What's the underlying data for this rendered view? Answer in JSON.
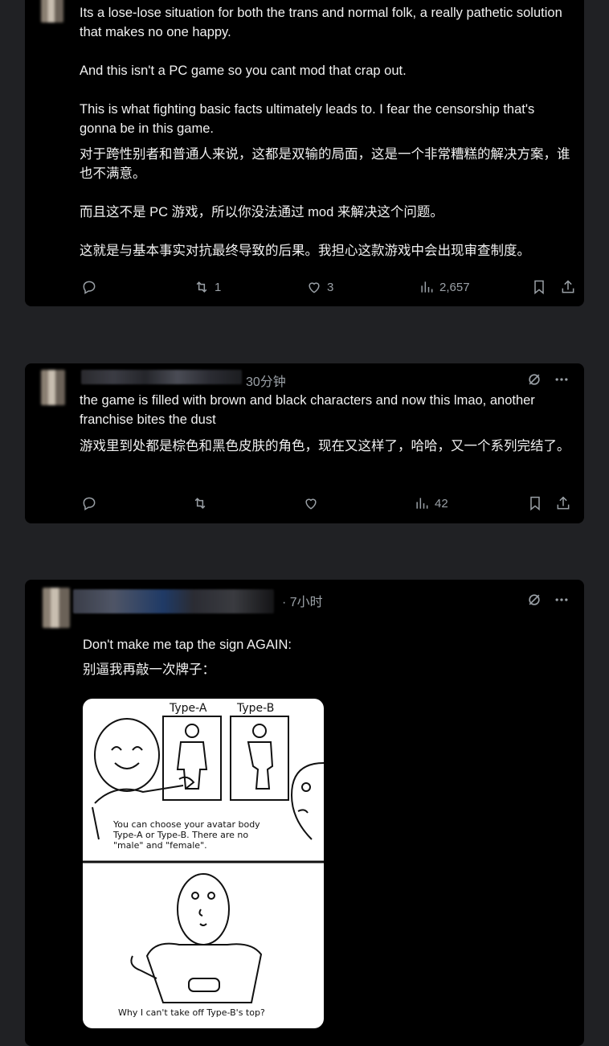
{
  "posts": [
    {
      "text_en": "Its a lose-lose situation for both the trans and normal folk, a really pathetic solution that makes no one happy.\n\nAnd this isn't a PC game so you cant mod that crap out.\n\nThis is what fighting basic facts ultimately leads to. I fear the censorship that's gonna be in this game.",
      "text_zh": "对于跨性别者和普通人来说，这都是双输的局面，这是一个非常糟糕的解决方案，谁也不满意。\n\n而且这不是 PC 游戏，所以你没法通过 mod 来解决这个问题。\n\n这就是与基本事实对抗最终导致的后果。我担心这款游戏中会出现审查制度。",
      "reposts": "1",
      "likes": "3",
      "views": "2,657"
    },
    {
      "time": "30分钟",
      "text_en": "the game is filled with brown and black characters and now this lmao, another franchise bites the dust",
      "text_zh": "游戏里到处都是棕色和黑色皮肤的角色，现在又这样了，哈哈，又一个系列完结了。",
      "views": "42"
    },
    {
      "time": "· 7小时",
      "text_en": "Don't make me tap the sign AGAIN:",
      "text_zh": "别逼我再敲一次牌子：",
      "meme": {
        "label_a": "Type-A",
        "label_b": "Type-B",
        "caption1": "You can choose your avatar body\nType-A or Type-B. There are no\n\"male\" and \"female\".",
        "caption2": "Why I can't take off Type-B's top?"
      }
    }
  ],
  "icons": [
    "reply-icon",
    "repost-icon",
    "like-icon",
    "views-icon",
    "bookmark-icon",
    "share-icon",
    "grok-icon",
    "more-icon"
  ]
}
